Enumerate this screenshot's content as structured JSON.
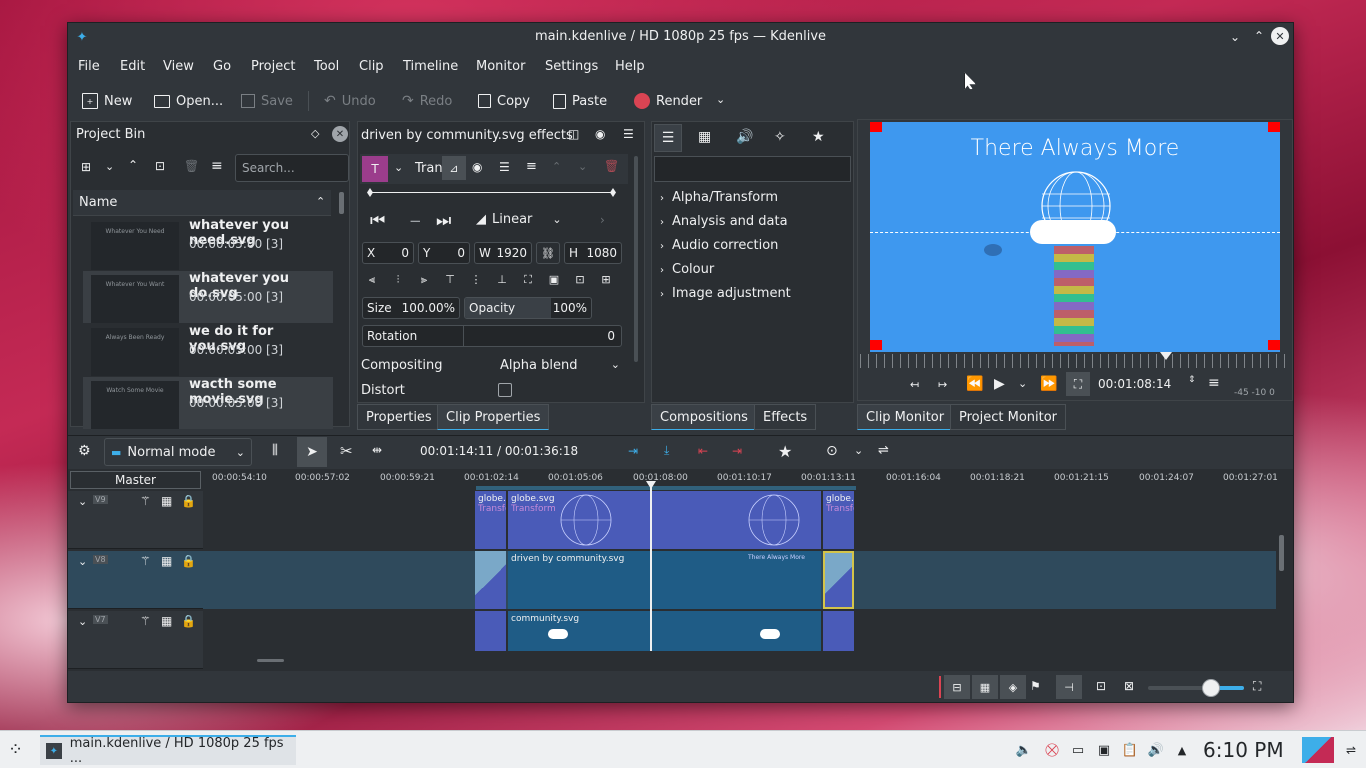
{
  "window": {
    "title": "main.kdenlive / HD 1080p 25 fps — Kdenlive"
  },
  "menu": [
    "File",
    "Edit",
    "View",
    "Go",
    "Project",
    "Tool",
    "Clip",
    "Timeline",
    "Monitor",
    "Settings",
    "Help"
  ],
  "toolbar": {
    "new": "New",
    "open": "Open...",
    "save": "Save",
    "undo": "Undo",
    "redo": "Redo",
    "copy": "Copy",
    "paste": "Paste",
    "render": "Render"
  },
  "project_bin": {
    "title": "Project Bin",
    "search_placeholder": "Search...",
    "column_name": "Name",
    "items": [
      {
        "name": "whatever you need.svg",
        "duration": "00:00:05:00 [3]",
        "thumb": "Whatever You Need"
      },
      {
        "name": "whatever you do.svg",
        "duration": "00:00:05:00 [3]",
        "thumb": "Whatever You Want"
      },
      {
        "name": "we do it for you.svg",
        "duration": "00:00:05:00 [3]",
        "thumb": "Always Been Ready"
      },
      {
        "name": "wacth some movie.svg",
        "duration": "00:00:05:00 [3]",
        "thumb": "Watch Some Movie"
      }
    ]
  },
  "effects_panel": {
    "title": "driven by community.svg effects",
    "effect_name": "Tran",
    "interpolation": "Linear",
    "x_label": "X",
    "x_value": "0",
    "y_label": "Y",
    "y_value": "0",
    "w_label": "W",
    "w_value": "1920",
    "h_label": "H",
    "h_value": "1080",
    "size_label": "Size",
    "size_value": "100.00%",
    "opacity_label": "Opacity",
    "opacity_value": "100%",
    "rotation_label": "Rotation",
    "rotation_value": "0",
    "compositing_label": "Compositing",
    "compositing_value": "Alpha blend",
    "distort_label": "Distort",
    "tabs": [
      "Properties",
      "Clip Properties"
    ]
  },
  "effects_list": {
    "categories": [
      "Alpha/Transform",
      "Analysis and data",
      "Audio correction",
      "Colour",
      "Image adjustment"
    ],
    "tabs": [
      "Compositions",
      "Effects"
    ]
  },
  "monitor": {
    "overlay_text": "There Always More",
    "timecode": "00:01:08:14",
    "audio_scale": "-45  -10  0",
    "tabs": [
      "Clip Monitor",
      "Project Monitor"
    ]
  },
  "timeline_toolbar": {
    "mode": "Normal mode",
    "timecode": "00:01:14:11 / 00:01:36:18"
  },
  "timeline": {
    "master_label": "Master",
    "ruler": [
      "00:00:54:10",
      "00:00:57:02",
      "00:00:59:21",
      "00:01:02:14",
      "00:01:05:06",
      "00:01:08:00",
      "00:01:10:17",
      "00:01:13:11",
      "00:01:16:04",
      "00:01:18:21",
      "00:01:21:15",
      "00:01:24:07",
      "00:01:27:01"
    ],
    "tracks": [
      {
        "name": "V9"
      },
      {
        "name": "V8"
      },
      {
        "name": "V7"
      }
    ],
    "clips": {
      "v9_a": "globe.s",
      "v9_a_sub": "Transfo",
      "v9_b": "globe.svg",
      "v9_b_sub": "Transform",
      "v9_c": "globe.",
      "v9_c_sub": "Transfo",
      "v8_b": "driven by community.svg",
      "v8_thumb": "There Always More",
      "v7_b": "community.svg"
    }
  },
  "taskbar": {
    "task_label": "main.kdenlive / HD 1080p 25 fps ...",
    "clock": "6:10 PM"
  },
  "colors": {
    "accent": "#3daee9",
    "clip_blue": "#4a5bb8",
    "clip_teal": "#1f5c86",
    "render_red": "#da4453"
  }
}
